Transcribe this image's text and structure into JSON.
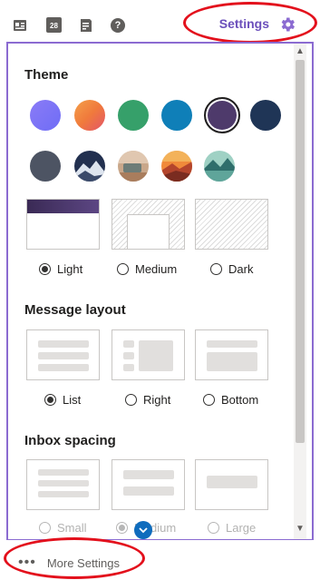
{
  "toolbar": {
    "icons": [
      "contact-card-icon",
      "calendar-icon",
      "notes-icon",
      "help-icon"
    ],
    "calendar_day": "28",
    "help_glyph": "?",
    "settings_label": "Settings"
  },
  "theme": {
    "title": "Theme",
    "swatch_colors": [
      "#6f6df5",
      "#f07a3c",
      "#36a06a",
      "#0f7fb8",
      "#4e3a6b",
      "#1f3556"
    ],
    "selected_index": 4,
    "image_swatches": [
      "dark-grey-swatch",
      "mountain-swatch",
      "desert-swatch",
      "sunset-swatch",
      "lake-swatch"
    ],
    "modes": [
      {
        "label": "Light",
        "checked": true
      },
      {
        "label": "Medium",
        "checked": false
      },
      {
        "label": "Dark",
        "checked": false
      }
    ]
  },
  "message_layout": {
    "title": "Message layout",
    "options": [
      {
        "label": "List",
        "checked": true
      },
      {
        "label": "Right",
        "checked": false
      },
      {
        "label": "Bottom",
        "checked": false
      }
    ]
  },
  "inbox_spacing": {
    "title": "Inbox spacing",
    "options": [
      {
        "label": "Small",
        "checked": false
      },
      {
        "label": "Medium",
        "checked": true
      },
      {
        "label": "Large",
        "checked": false
      }
    ]
  },
  "footer": {
    "more_settings_label": "More Settings",
    "dots": "•••"
  },
  "colors": {
    "accent": "#6b4fbb",
    "annotation": "#e3101c",
    "brand_blue": "#0f6cbd"
  }
}
